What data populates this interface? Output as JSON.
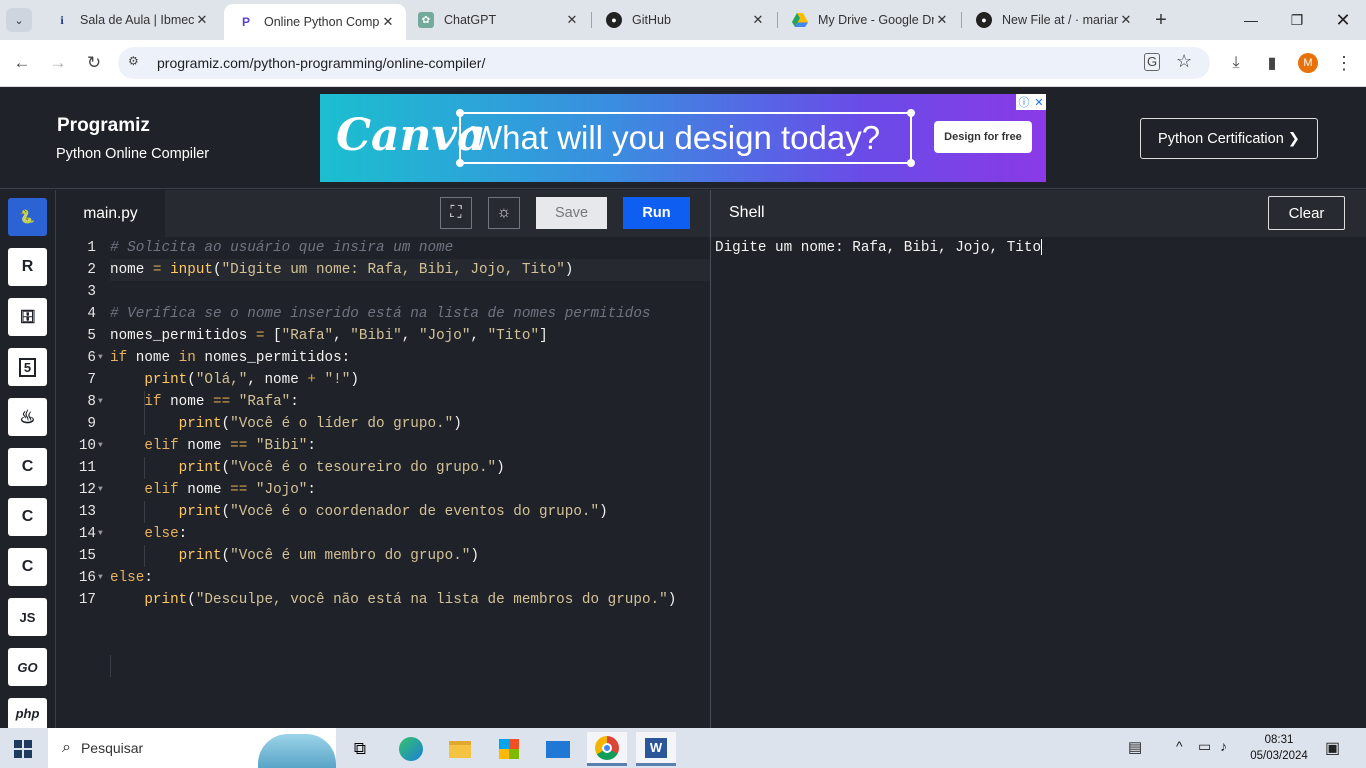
{
  "browser": {
    "tabs": [
      {
        "title": "Sala de Aula | Ibmec",
        "icon": "ibmec-icon"
      },
      {
        "title": "Online Python Compi",
        "icon": "programiz-icon"
      },
      {
        "title": "ChatGPT",
        "icon": "chatgpt-icon"
      },
      {
        "title": "GitHub",
        "icon": "github-icon"
      },
      {
        "title": "My Drive - Google Dr",
        "icon": "google-drive-icon"
      },
      {
        "title": "New File at / · mariar",
        "icon": "github-icon"
      }
    ],
    "url": "programiz.com/python-programming/online-compiler/",
    "profile_initial": "M"
  },
  "header": {
    "logo": "Programiz",
    "subtitle": "Python Online Compiler",
    "ad": {
      "brand": "Canva",
      "headline": "What will you design today?",
      "cta": "Design for free"
    },
    "certification": "Python Certification ❯"
  },
  "sidebar": {
    "languages": [
      {
        "name": "python",
        "label": "",
        "glyph": "🐍"
      },
      {
        "name": "r",
        "label": "R",
        "glyph": ""
      },
      {
        "name": "sql",
        "label": "",
        "glyph": "🗄"
      },
      {
        "name": "html",
        "label": "5",
        "glyph": ""
      },
      {
        "name": "java",
        "label": "",
        "glyph": "♨"
      },
      {
        "name": "c",
        "label": "C",
        "glyph": ""
      },
      {
        "name": "cpp",
        "label": "C",
        "glyph": ""
      },
      {
        "name": "csharp",
        "label": "C",
        "glyph": ""
      },
      {
        "name": "javascript",
        "label": "JS",
        "glyph": ""
      },
      {
        "name": "go",
        "label": "GO",
        "glyph": ""
      },
      {
        "name": "php",
        "label": "php",
        "glyph": ""
      }
    ]
  },
  "editor": {
    "filename": "main.py",
    "save": "Save",
    "run": "Run",
    "lines": [
      {
        "n": "1",
        "text": "# Solicita ao usuário que insira um nome"
      },
      {
        "n": "2",
        "text": "nome = input(\"Digite um nome: Rafa, Bibi, Jojo, Tito\")"
      },
      {
        "n": "3",
        "text": ""
      },
      {
        "n": "4",
        "text": "# Verifica se o nome inserido está na lista de nomes permitidos"
      },
      {
        "n": "5",
        "text": "nomes_permitidos = [\"Rafa\", \"Bibi\", \"Jojo\", \"Tito\"]"
      },
      {
        "n": "6",
        "text": "if nome in nomes_permitidos:"
      },
      {
        "n": "7",
        "text": "    print(\"Olá,\", nome + \"!\")"
      },
      {
        "n": "8",
        "text": "    if nome == \"Rafa\":"
      },
      {
        "n": "9",
        "text": "        print(\"Você é o líder do grupo.\")"
      },
      {
        "n": "10",
        "text": "    elif nome == \"Bibi\":"
      },
      {
        "n": "11",
        "text": "        print(\"Você é o tesoureiro do grupo.\")"
      },
      {
        "n": "12",
        "text": "    elif nome == \"Jojo\":"
      },
      {
        "n": "13",
        "text": "        print(\"Você é o coordenador de eventos do grupo.\")"
      },
      {
        "n": "14",
        "text": "    else:"
      },
      {
        "n": "15",
        "text": "        print(\"Você é um membro do grupo.\")"
      },
      {
        "n": "16",
        "text": "else:"
      },
      {
        "n": "17",
        "text": "    print(\"Desculpe, você não está na lista de membros do grupo.\")"
      }
    ]
  },
  "shell": {
    "title": "Shell",
    "clear": "Clear",
    "output": "Digite um nome: Rafa, Bibi, Jojo, Tito"
  },
  "taskbar": {
    "search": "Pesquisar",
    "time": "08:31",
    "date": "05/03/2024"
  }
}
